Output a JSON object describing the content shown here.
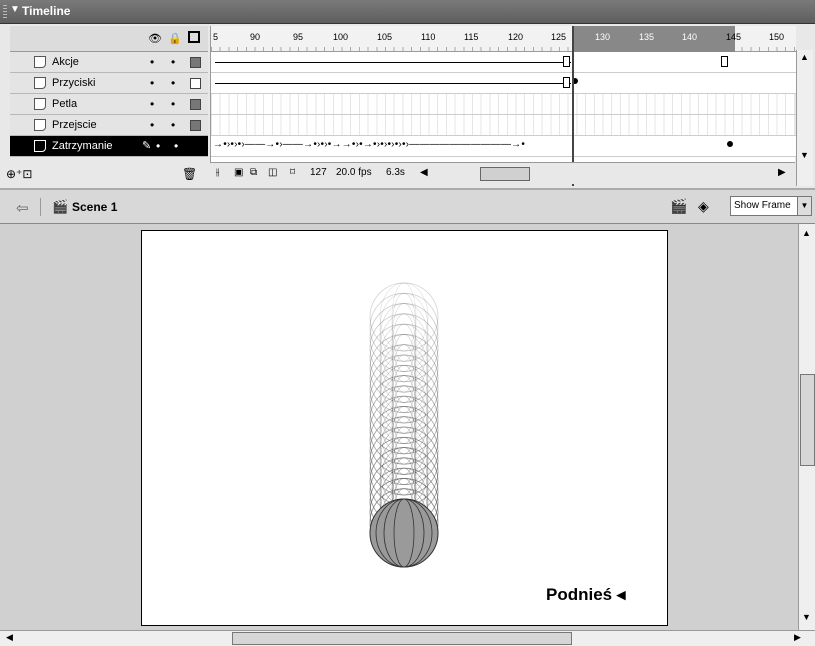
{
  "panel": {
    "title": "Timeline",
    "collapse_glyph": "▼"
  },
  "layers": [
    {
      "name": "Akcje",
      "dots": true,
      "square": "filled"
    },
    {
      "name": "Przyciski",
      "dots": true,
      "square": "empty"
    },
    {
      "name": "Petla",
      "dots": true,
      "square": "filled"
    },
    {
      "name": "Przejscie",
      "dots": true,
      "square": "filled"
    },
    {
      "name": "Zatrzymanie",
      "dots": true,
      "square": "none",
      "selected": true
    }
  ],
  "ruler": {
    "labels": [
      "5",
      "90",
      "95",
      "100",
      "105",
      "110",
      "115",
      "120",
      "125",
      "130",
      "135",
      "140",
      "145",
      "150"
    ]
  },
  "frames_footer": {
    "current_frame": "127",
    "frame_rate": "20.0 fps",
    "elapsed_time": "6.3s"
  },
  "tween_glyphs": "→•›•›•›——→•›——→•›•›•→→•›•→•›•›•›•›•›——————————→•",
  "editbar": {
    "scene_name": "Scene 1",
    "frame_select": "Show Frame"
  },
  "stage": {
    "label": "Podnieś ◂"
  },
  "colors": {
    "ball_fill": "#9a9a9a",
    "selected_layer_bg": "#000000",
    "title_bar": "#6b6b6b"
  }
}
